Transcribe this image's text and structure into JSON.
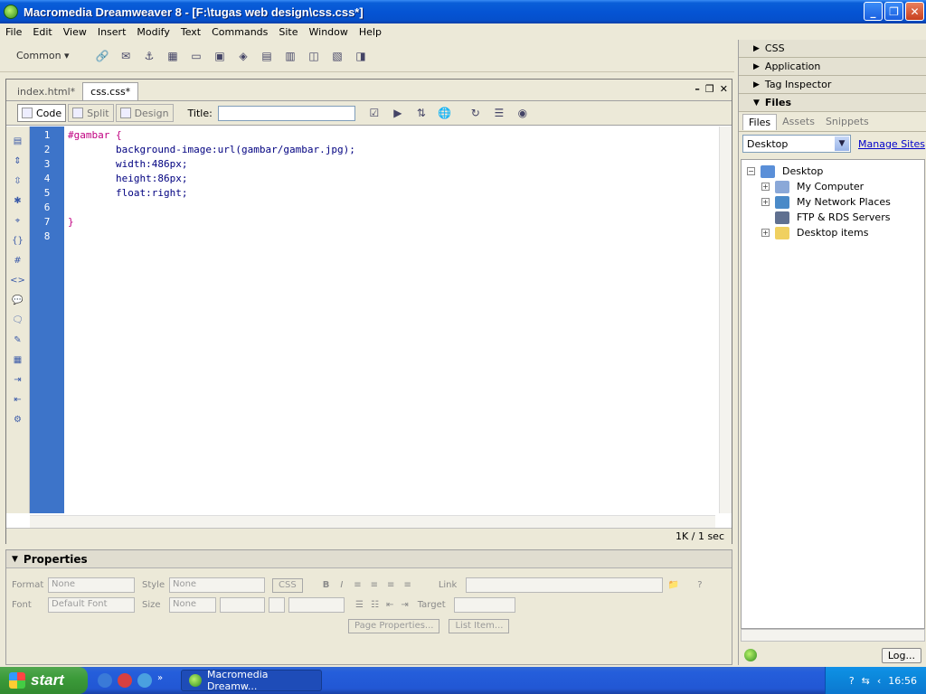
{
  "window": {
    "title": "Macromedia Dreamweaver 8 - [F:\\tugas web design\\css.css*]",
    "minimize": "_",
    "restore": "❐",
    "close": "✕"
  },
  "menu": [
    "File",
    "Edit",
    "View",
    "Insert",
    "Modify",
    "Text",
    "Commands",
    "Site",
    "Window",
    "Help"
  ],
  "insert_bar": {
    "category": "Common"
  },
  "document": {
    "tabs": [
      {
        "label": "index.html*",
        "active": false
      },
      {
        "label": "css.css*",
        "active": true
      }
    ],
    "views": {
      "code": "Code",
      "split": "Split",
      "design": "Design"
    },
    "title_label": "Title:",
    "title_value": "",
    "code_lines": [
      {
        "num": "1",
        "text": "#gambar {"
      },
      {
        "num": "2",
        "text": "\tbackground-image:url(gambar/gambar.jpg);"
      },
      {
        "num": "3",
        "text": "\twidth:486px;"
      },
      {
        "num": "4",
        "text": "\theight:86px;"
      },
      {
        "num": "5",
        "text": "\tfloat:right;"
      },
      {
        "num": "6",
        "text": ""
      },
      {
        "num": "7",
        "text": "}"
      },
      {
        "num": "8",
        "text": ""
      }
    ],
    "status": "1K / 1 sec"
  },
  "properties": {
    "title": "Properties",
    "format_label": "Format",
    "format_value": "None",
    "style_label": "Style",
    "style_value": "None",
    "css_button": "CSS",
    "link_label": "Link",
    "font_label": "Font",
    "font_value": "Default Font",
    "size_label": "Size",
    "size_value": "None",
    "target_label": "Target",
    "page_properties": "Page Properties...",
    "list_item": "List Item..."
  },
  "right_panel": {
    "groups": [
      "CSS",
      "Application",
      "Tag Inspector"
    ],
    "files_group": "Files",
    "file_tabs": [
      "Files",
      "Assets",
      "Snippets"
    ],
    "site_select": "Desktop",
    "manage_sites": "Manage Sites",
    "tree": [
      {
        "label": "Desktop",
        "level": 0,
        "expander": "−"
      },
      {
        "label": "My Computer",
        "level": 1,
        "expander": "+"
      },
      {
        "label": "My Network Places",
        "level": 1,
        "expander": "+"
      },
      {
        "label": "FTP & RDS Servers",
        "level": 1,
        "expander": ""
      },
      {
        "label": "Desktop items",
        "level": 1,
        "expander": "+"
      }
    ],
    "log_button": "Log..."
  },
  "taskbar": {
    "start": "start",
    "task_item": "Macromedia Dreamw...",
    "clock": "16:56"
  },
  "colors": {
    "gutter": "#3d74c9",
    "selector": "#c00080",
    "property": "#000080",
    "titlebar": "#0554d4"
  }
}
